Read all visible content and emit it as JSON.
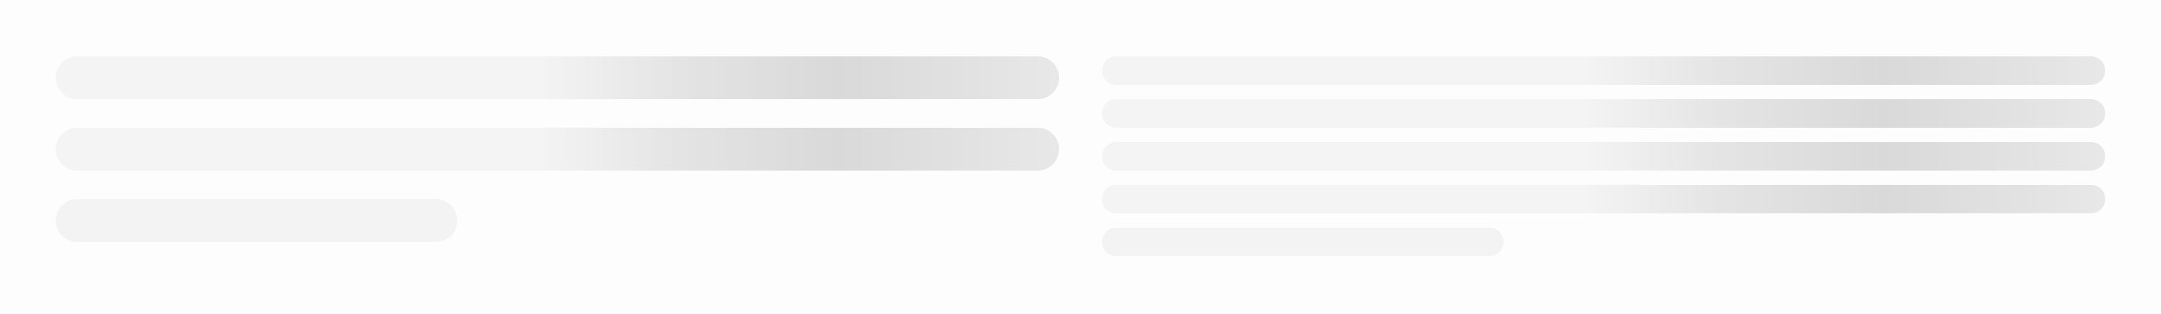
{
  "loading_state": {
    "left_placeholder": {
      "line_count": 3,
      "variant": "large"
    },
    "right_placeholder": {
      "line_count": 5,
      "variant": "small"
    },
    "colors": {
      "background": "#fdfdfd",
      "placeholder_base": "#f4f4f4",
      "placeholder_highlight": "#d9d9d9"
    }
  }
}
